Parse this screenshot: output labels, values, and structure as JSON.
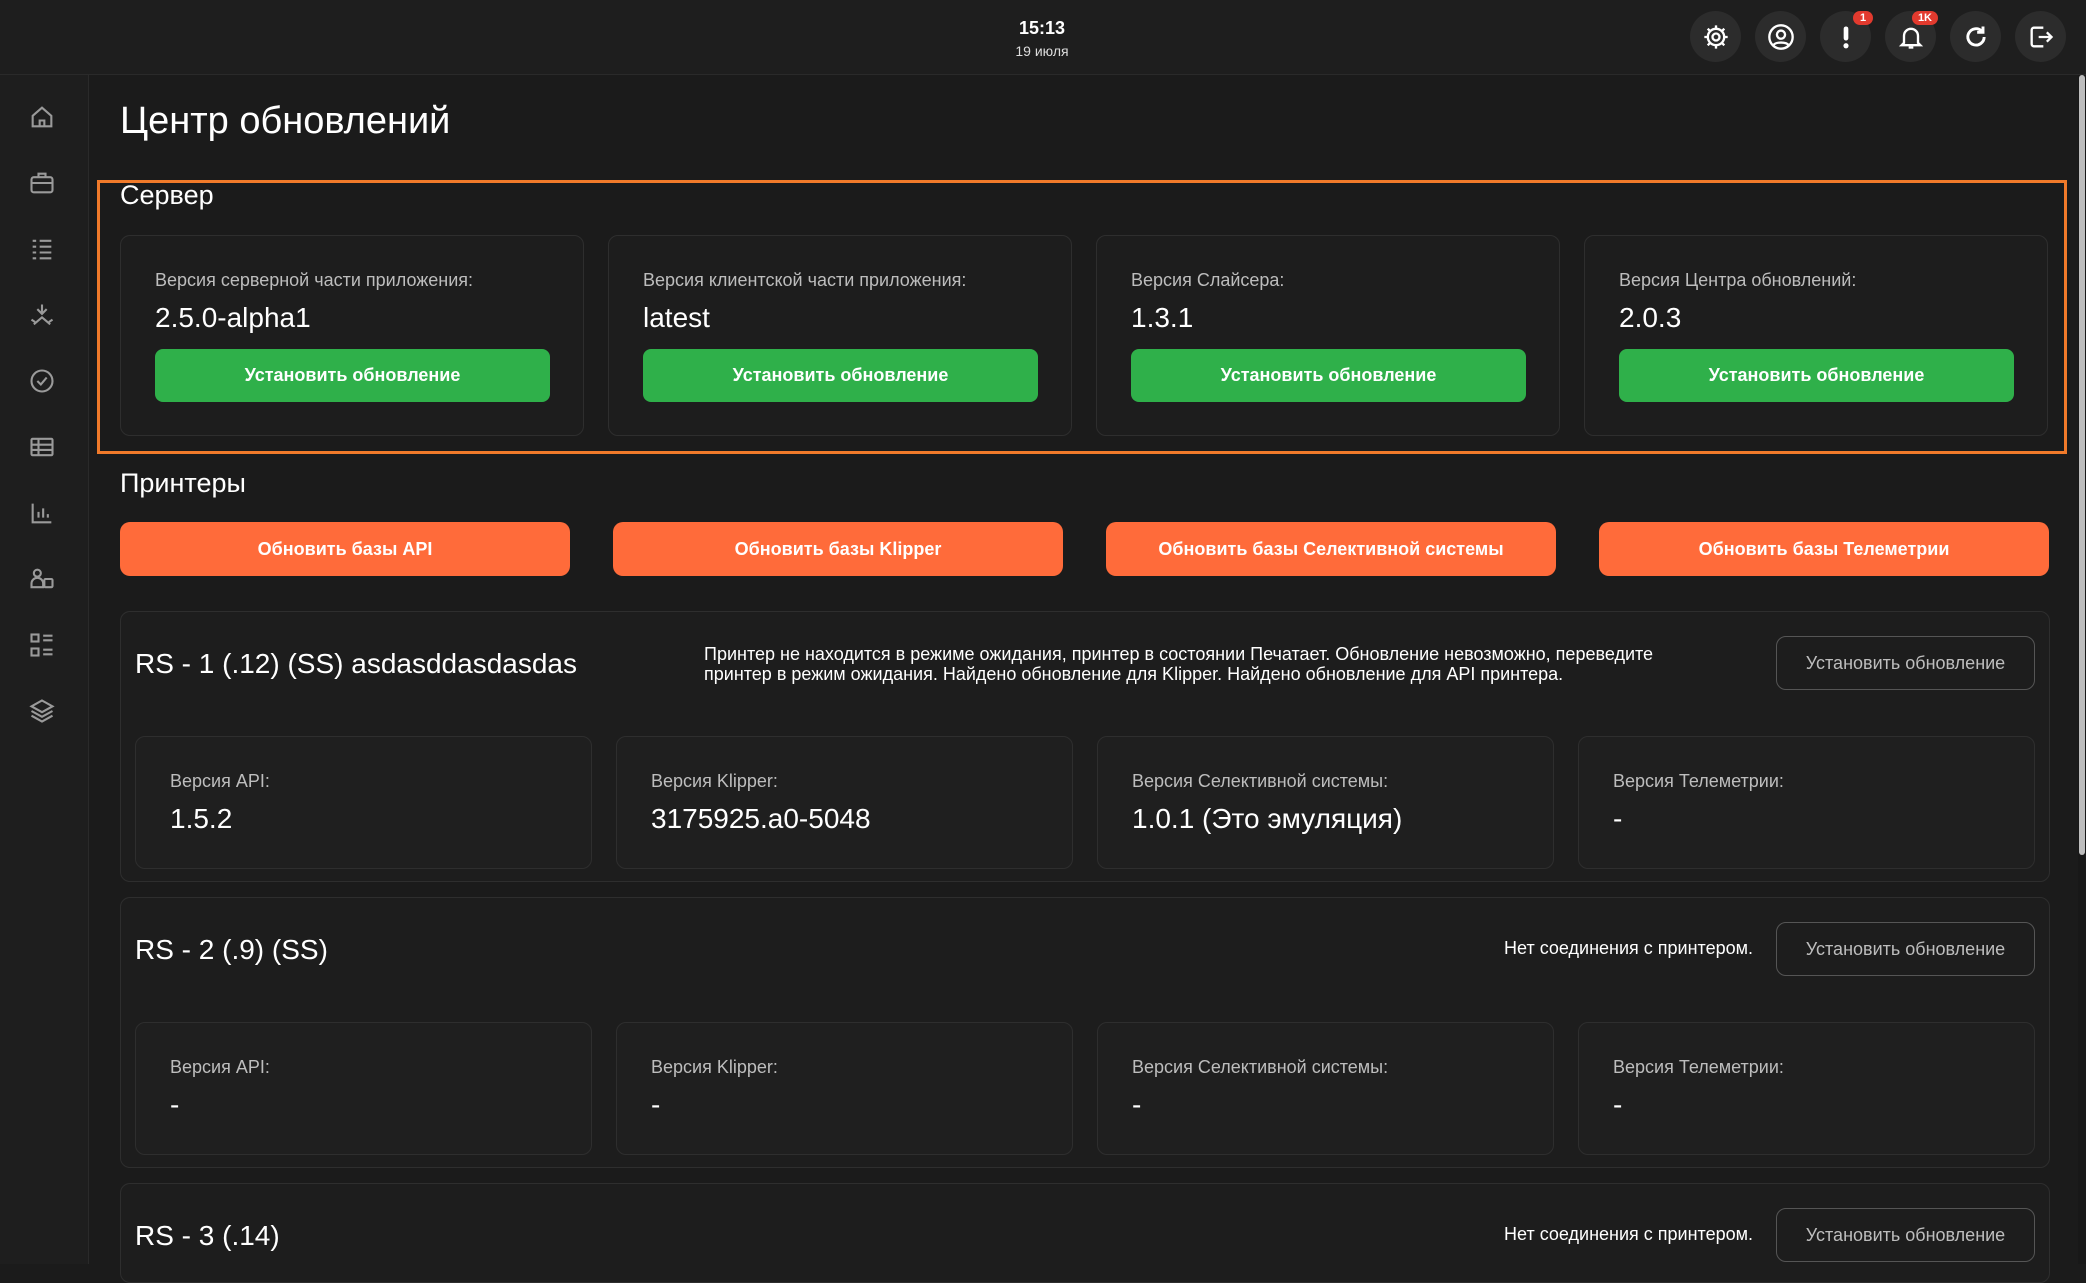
{
  "header": {
    "time": "15:13",
    "date": "19 июля",
    "alerts_badge": "1",
    "notifications_badge": "1K"
  },
  "page_title": "Центр обновлений",
  "server": {
    "title": "Сервер",
    "cards": [
      {
        "label": "Версия серверной части приложения:",
        "value": "2.5.0-alpha1",
        "button": "Установить обновление"
      },
      {
        "label": "Версия клиентской части приложения:",
        "value": "latest",
        "button": "Установить обновление"
      },
      {
        "label": "Версия Слайсера:",
        "value": "1.3.1",
        "button": "Установить обновление"
      },
      {
        "label": "Версия Центра обновлений:",
        "value": "2.0.3",
        "button": "Установить обновление"
      }
    ]
  },
  "printers": {
    "title": "Принтеры",
    "actions": [
      "Обновить базы API",
      "Обновить базы Klipper",
      "Обновить базы Селективной системы",
      "Обновить базы Телеметрии"
    ],
    "items": [
      {
        "name": "RS - 1 (.12) (SS) asdasddasdasdas",
        "status_line1": "Принтер не находится в режиме ожидания, принтер в состоянии Печатает. Обновление невозможно, переведите",
        "status_line2": "принтер в режим ожидания. Найдено обновление для Klipper. Найдено обновление для API принтера.",
        "button": "Установить обновление",
        "versions": [
          {
            "label": "Версия API:",
            "value": "1.5.2"
          },
          {
            "label": "Версия Klipper:",
            "value": "3175925.a0-5048"
          },
          {
            "label": "Версия Селективной системы:",
            "value": "1.0.1 (Это эмуляция)"
          },
          {
            "label": "Версия Телеметрии:",
            "value": "-"
          }
        ]
      },
      {
        "name": "RS - 2 (.9) (SS)",
        "status": "Нет соединения с принтером.",
        "button": "Установить обновление",
        "versions": [
          {
            "label": "Версия API:",
            "value": "-"
          },
          {
            "label": "Версия Klipper:",
            "value": "-"
          },
          {
            "label": "Версия Селективной системы:",
            "value": "-"
          },
          {
            "label": "Версия Телеметрии:",
            "value": "-"
          }
        ]
      },
      {
        "name": "RS - 3 (.14)",
        "status": "Нет соединения с принтером.",
        "button": "Установить обновление"
      }
    ]
  },
  "colors": {
    "accent_green": "#2fb04a",
    "accent_orange": "#ff6b3a",
    "highlight_border": "#f07a2a",
    "background": "#1b1b1b"
  }
}
